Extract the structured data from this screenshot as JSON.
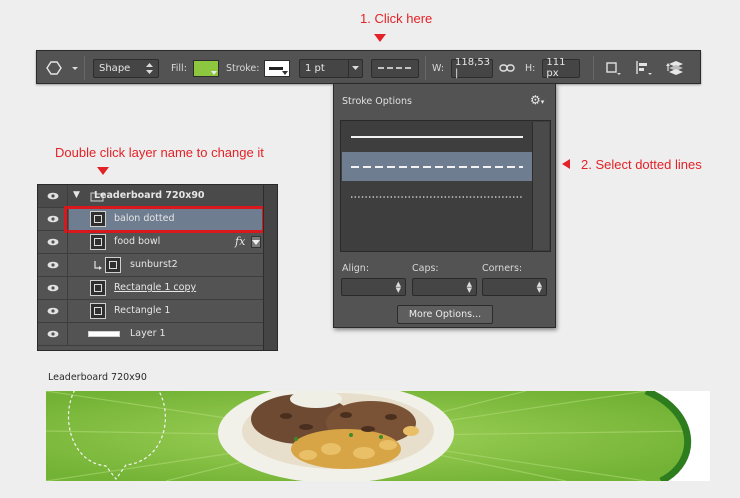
{
  "annotations": {
    "step1": "1. Click here",
    "step2": "2. Select dotted lines",
    "layer_hint": "Double click layer name to change it"
  },
  "toolbar": {
    "mode": "Shape",
    "fill_label": "Fill:",
    "fill_color": "#8dc63f",
    "stroke_label": "Stroke:",
    "stroke_width": "1 pt",
    "w_label": "W:",
    "w_value": "118,53 |",
    "h_label": "H:",
    "h_value": "111 px"
  },
  "stroke_options": {
    "title": "Stroke Options",
    "styles": [
      "solid",
      "dashed",
      "dotted"
    ],
    "selected": "dashed",
    "align_label": "Align:",
    "caps_label": "Caps:",
    "corners_label": "Corners:",
    "more_button": "More Options..."
  },
  "layers": {
    "group_name": "Leaderboard 720x90",
    "items": [
      {
        "name": "balon dotted",
        "selected": true
      },
      {
        "name": "food bowl",
        "fx": "fx"
      },
      {
        "name": "sunburst2"
      },
      {
        "name": "Rectangle 1 copy"
      },
      {
        "name": "Rectangle 1"
      },
      {
        "name": "Layer 1"
      }
    ]
  },
  "banner": {
    "title": "Leaderboard 720x90",
    "green": "#7cbb3a",
    "dark_green": "#2d7d1e"
  },
  "colors": {
    "annotation": "#e32227",
    "selection": "#6f7d90",
    "panel": "#535353"
  }
}
